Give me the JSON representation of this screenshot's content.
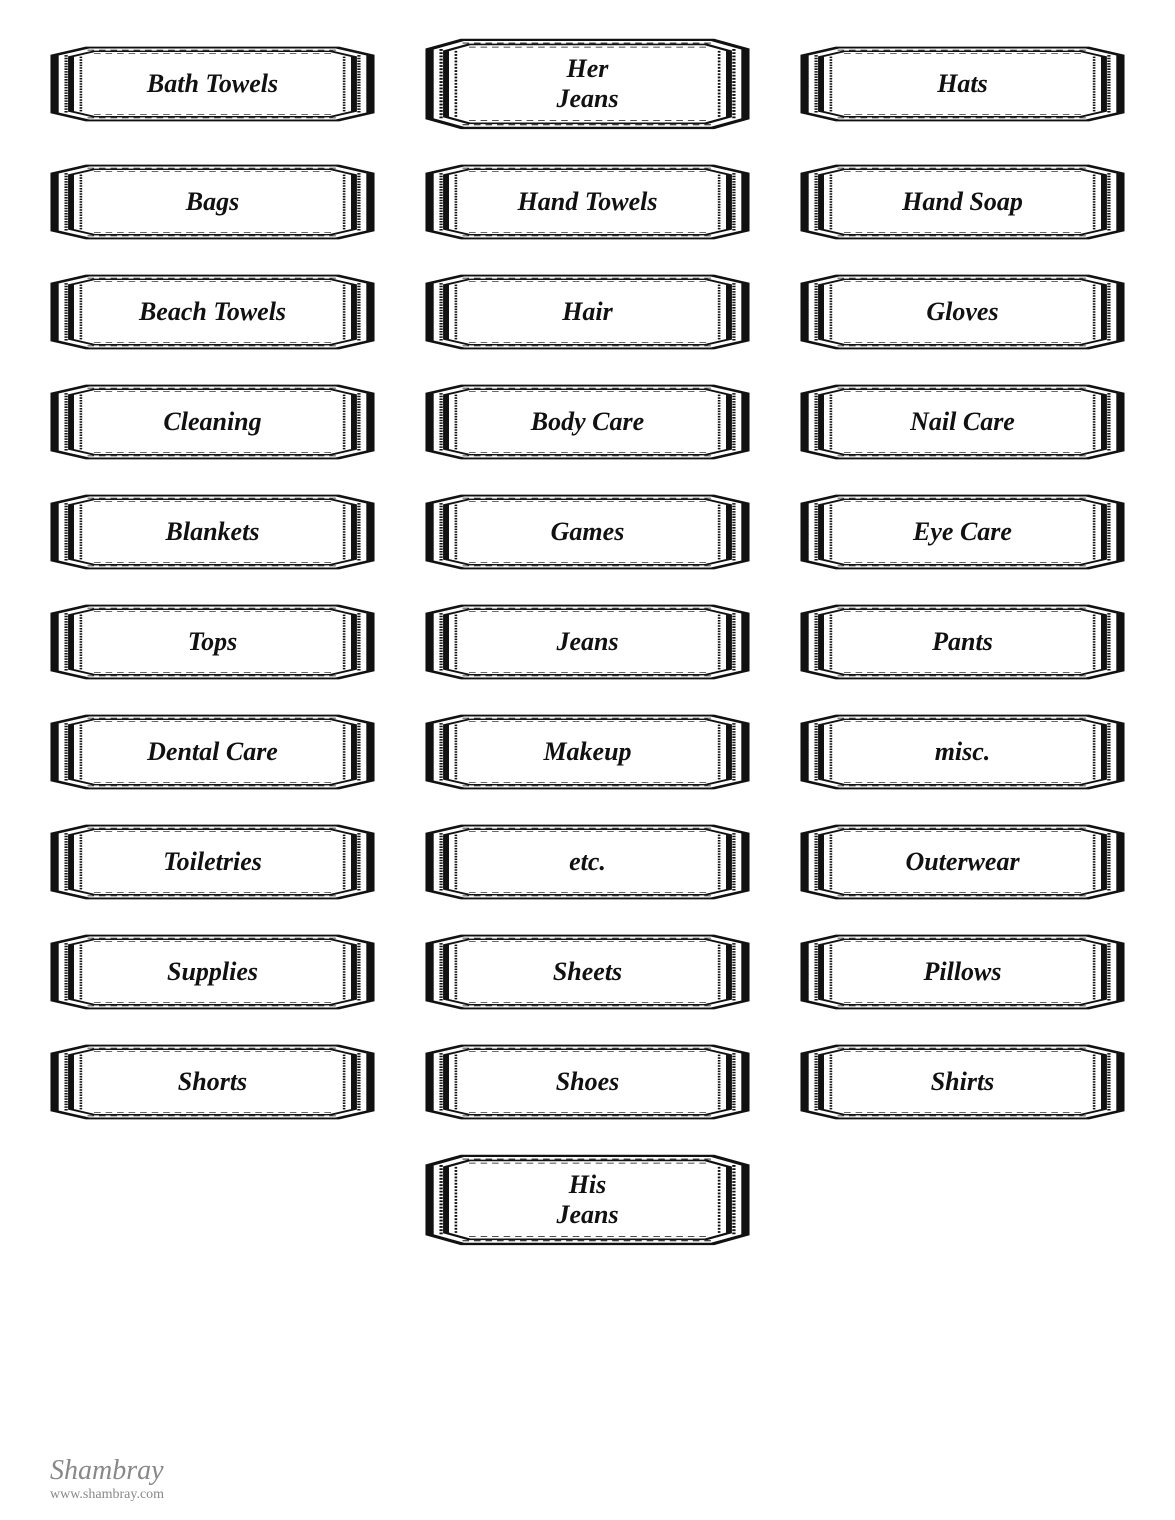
{
  "labels": [
    [
      "Bath Towels",
      "Her\nJeans",
      "Hats"
    ],
    [
      "Bags",
      "Hand Towels",
      "Hand Soap"
    ],
    [
      "Beach Towels",
      "Hair",
      "Gloves"
    ],
    [
      "Cleaning",
      "Body Care",
      "Nail Care"
    ],
    [
      "Blankets",
      "Games",
      "Eye Care"
    ],
    [
      "Tops",
      "Jeans",
      "Pants"
    ],
    [
      "Dental Care",
      "Makeup",
      "misc."
    ],
    [
      "Toiletries",
      "etc.",
      "Outerwear"
    ],
    [
      "Supplies",
      "Sheets",
      "Pillows"
    ],
    [
      "Shorts",
      "Shoes",
      "Shirts"
    ],
    [
      "",
      "His\nJeans",
      ""
    ]
  ],
  "watermark": {
    "brand": "Shambray",
    "url": "www.shambray.com"
  }
}
